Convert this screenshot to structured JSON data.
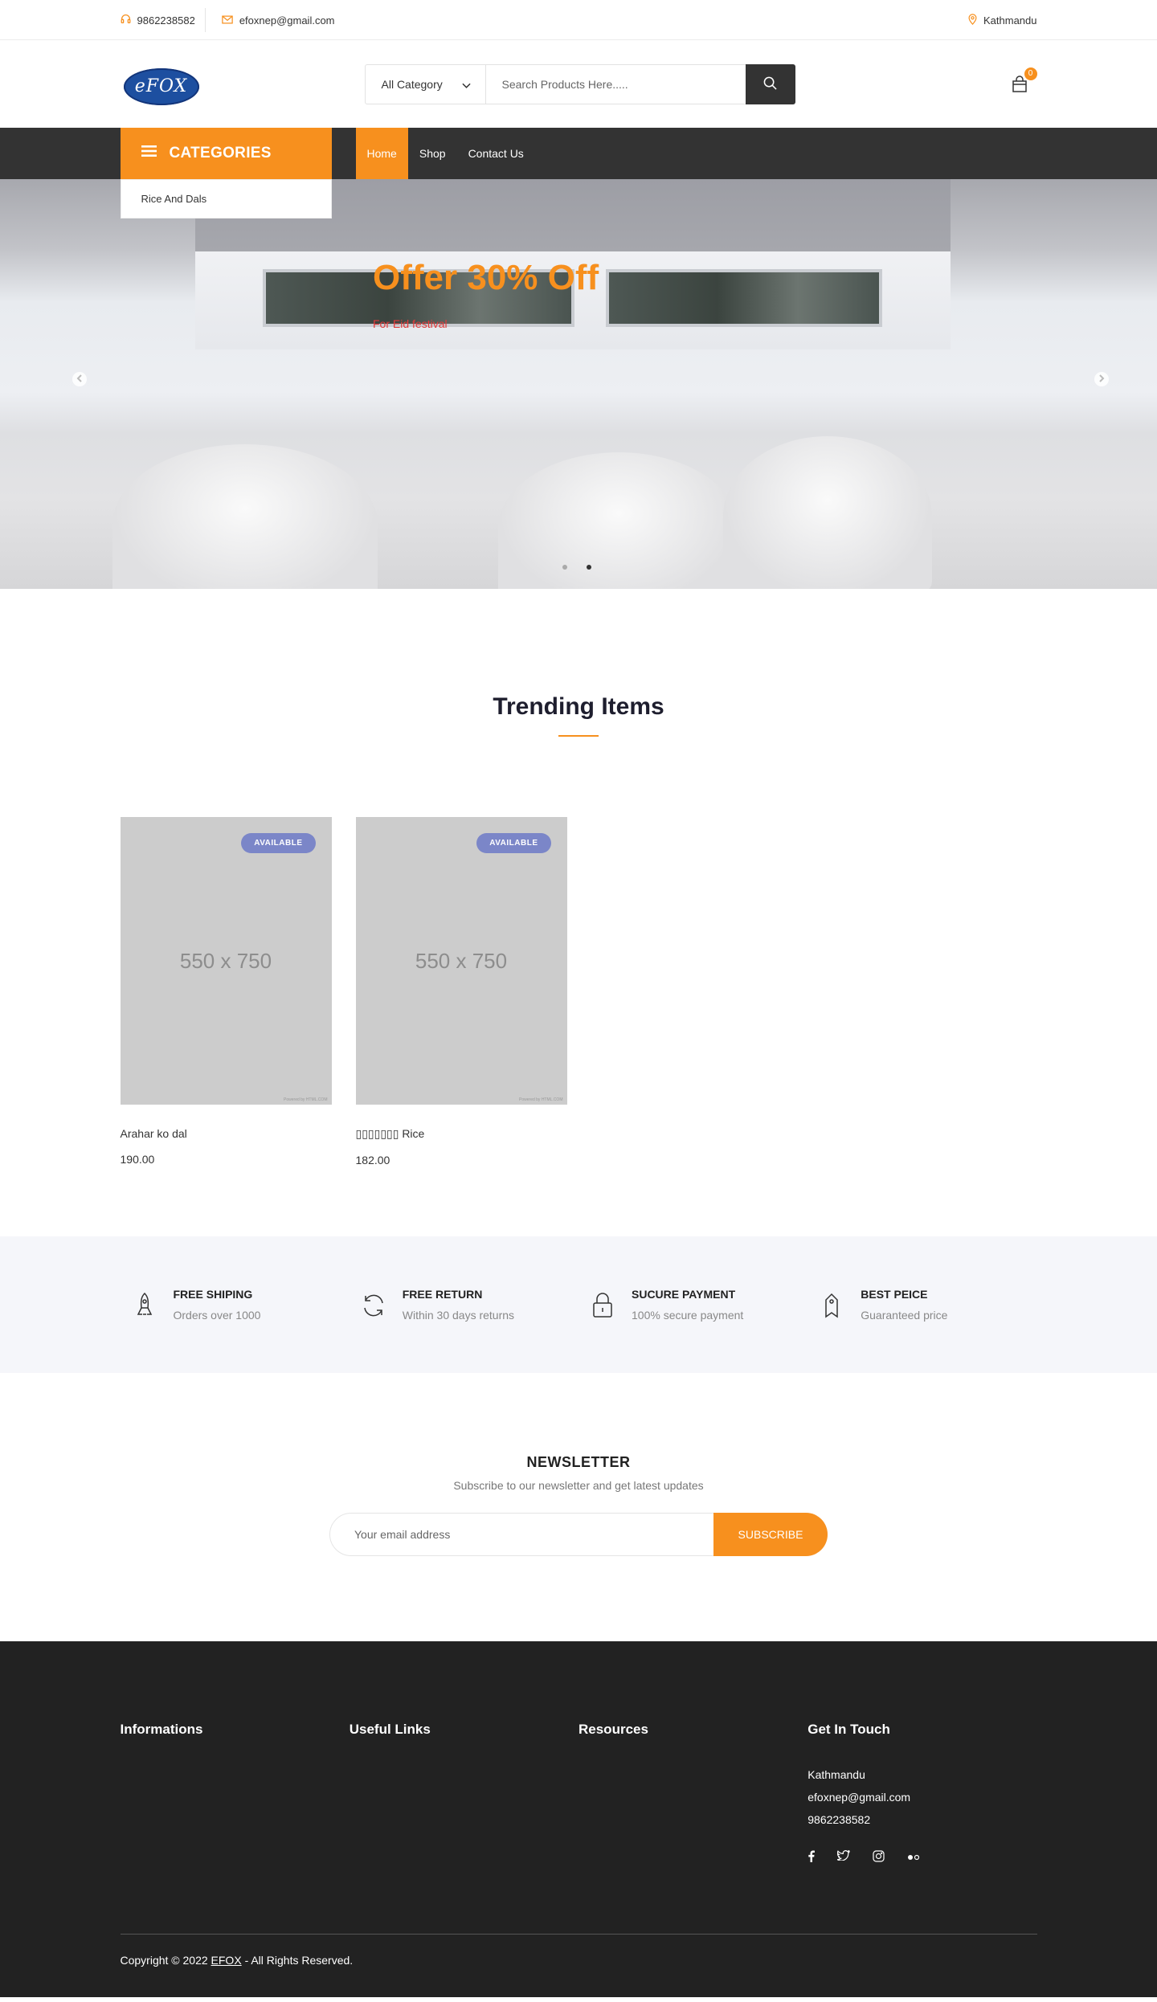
{
  "topbar": {
    "phone": "9862238582",
    "email": "efoxnep@gmail.com",
    "location": "Kathmandu"
  },
  "header": {
    "logo_text": "eFOX",
    "search": {
      "category": "All Category",
      "placeholder": "Search Products Here....."
    },
    "cart_count": "0"
  },
  "nav": {
    "categories_label": "CATEGORIES",
    "category_items": [
      "Rice And Dals"
    ],
    "links": [
      "Home",
      "Shop",
      "Contact Us"
    ]
  },
  "hero": {
    "title": "Offer 30% Off",
    "subtitle": "For Eid festival"
  },
  "trending": {
    "title": "Trending Items",
    "products": [
      {
        "image_text": "550 x 750",
        "badge": "AVAILABLE",
        "name": "Arahar ko dal",
        "price": "190.00",
        "watermark": "Powered by HTML.COM"
      },
      {
        "image_text": "550 x 750",
        "badge": "AVAILABLE",
        "name": "▯▯▯▯▯▯▯ Rice",
        "price": "182.00",
        "watermark": "Powered by HTML.COM"
      }
    ]
  },
  "features": [
    {
      "icon": "rocket-icon",
      "title": "FREE SHIPING",
      "sub": "Orders over 1000"
    },
    {
      "icon": "refresh-icon",
      "title": "FREE RETURN",
      "sub": "Within 30 days returns"
    },
    {
      "icon": "lock-icon",
      "title": "SUCURE PAYMENT",
      "sub": "100% secure payment"
    },
    {
      "icon": "tag-icon",
      "title": "BEST PEICE",
      "sub": "Guaranteed price"
    }
  ],
  "newsletter": {
    "title": "NEWSLETTER",
    "sub": "Subscribe to our newsletter and get latest updates",
    "placeholder": "Your email address",
    "button": "SUBSCRIBE"
  },
  "footer": {
    "cols": [
      "Informations",
      "Useful Links",
      "Resources",
      "Get In Touch"
    ],
    "contact": {
      "location": "Kathmandu",
      "email": "efoxnep@gmail.com",
      "phone": "9862238582"
    },
    "social": [
      "facebook-icon",
      "twitter-icon",
      "instagram-icon",
      "flickr-icon"
    ],
    "copyright_prefix": "Copyright © 2022",
    "brand": "EFOX",
    "copyright_suffix": "- All Rights Reserved."
  },
  "colors": {
    "accent": "#f7901e",
    "dark": "#333333",
    "footer_bg": "#222222",
    "badge": "#7b86c8",
    "hero_sub": "#e23b3b"
  }
}
